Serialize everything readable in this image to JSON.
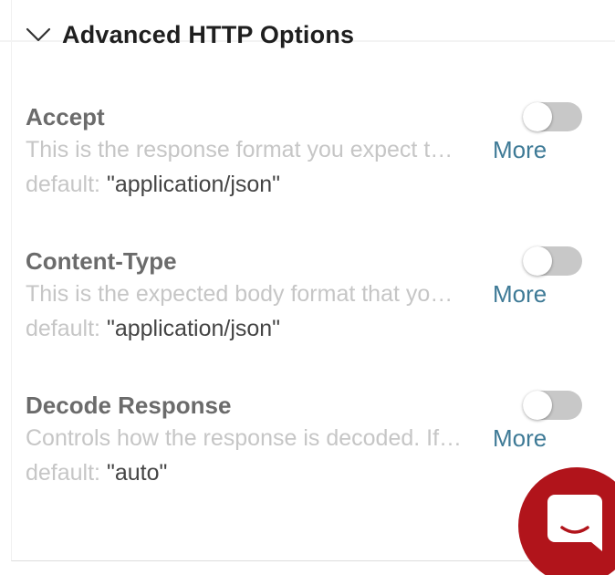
{
  "section": {
    "title": "Advanced HTTP Options"
  },
  "options": [
    {
      "title": "Accept",
      "description": "This is the response format you expect t…",
      "more_label": "More",
      "default_label": "default:",
      "default_value": "\"application/json\"",
      "enabled": false
    },
    {
      "title": "Content-Type",
      "description": "This is the expected body format that yo…",
      "more_label": "More",
      "default_label": "default:",
      "default_value": "\"application/json\"",
      "enabled": false
    },
    {
      "title": "Decode Response",
      "description": "Controls how the response is decoded. If…",
      "more_label": "More",
      "default_label": "default:",
      "default_value": "\"auto\"",
      "enabled": false
    }
  ],
  "icons": {
    "collapse": "chevron-down-icon",
    "chat": "chat-bubble-icon"
  },
  "colors": {
    "title": "#1f1f1f",
    "option_title": "#6b6b6b",
    "muted_text": "#c6c6c6",
    "link": "#3e7a96",
    "toggle_off": "#c8c8c8",
    "chat_button": "#b1141b"
  }
}
